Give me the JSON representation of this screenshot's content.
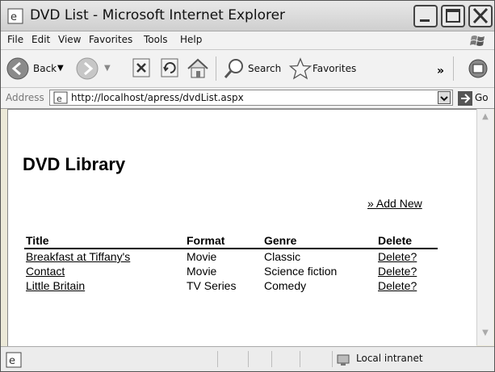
{
  "window": {
    "title": "DVD List - Microsoft Internet Explorer"
  },
  "menu": [
    "File",
    "Edit",
    "View",
    "Favorites",
    "Tools",
    "Help"
  ],
  "toolbar": {
    "back_label": "Back",
    "search_label": "Search",
    "favorites_label": "Favorites",
    "overflow": "»"
  },
  "address": {
    "label": "Address",
    "url": "http://localhost/apress/dvdList.aspx",
    "go_label": "Go"
  },
  "page": {
    "heading": "DVD Library",
    "add_new": "» Add New",
    "columns": [
      "Title",
      "Format",
      "Genre",
      "Delete"
    ],
    "rows": [
      {
        "title": "Breakfast at Tiffany's",
        "format": "Movie",
        "genre": "Classic",
        "delete": "Delete?"
      },
      {
        "title": "Contact",
        "format": "Movie",
        "genre": "Science fiction",
        "delete": "Delete?"
      },
      {
        "title": "Little Britain",
        "format": "TV Series",
        "genre": "Comedy",
        "delete": "Delete?"
      }
    ]
  },
  "status": {
    "zone": "Local intranet"
  }
}
